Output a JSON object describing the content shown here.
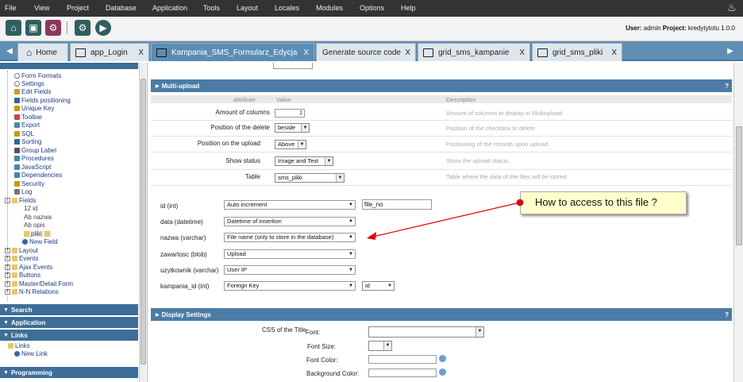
{
  "menu": [
    "File",
    "View",
    "Project",
    "Database",
    "Application",
    "Tools",
    "Layout",
    "Locales",
    "Modules",
    "Options",
    "Help"
  ],
  "icons": {
    "bell": "bell-icon",
    "home": "home-icon",
    "save": "save-icon",
    "gear": "gear-icon",
    "gears": "gears-icon",
    "run": "run-icon"
  },
  "userinfo": {
    "user_label": "User:",
    "user": "admin",
    "project_label": "Project:",
    "project": "kredytytotu",
    "version": "1.0.0"
  },
  "tabs": [
    {
      "label": "Home",
      "close": ""
    },
    {
      "label": "app_Login",
      "close": "X"
    },
    {
      "label": "Kampania_SMS_Formularz_Edycja",
      "close": "X"
    },
    {
      "label": "Generate source code",
      "close": "X"
    },
    {
      "label": "grid_sms_kampanie",
      "close": "X"
    },
    {
      "label": "grid_sms_pliki",
      "close": "X"
    }
  ],
  "tree": {
    "items": [
      "Form Formats",
      "Settings",
      "Edit Fields",
      "Fields positioning",
      "Unique Key",
      "Toolbar",
      "Export",
      "SQL",
      "Sorting",
      "Group Label",
      "Procedures",
      "JavaScript",
      "Dependencies",
      "Security",
      "Log",
      "Fields",
      "12 id",
      "Ab nazwa",
      "Ab opis",
      "pliki",
      "New Field",
      "Layout",
      "Events",
      "Ajax Events",
      "Buttons",
      "Master/Detail Form",
      "N-N Relations"
    ]
  },
  "sections": {
    "search": "Search",
    "application": "Application",
    "links": "Links",
    "programming": "Programming"
  },
  "links_items": [
    "Links",
    "New Link"
  ],
  "multiupload": {
    "title": "Multi-upload",
    "help": "?",
    "head": {
      "attribute": "Attribute",
      "value": "Value",
      "description": "Description"
    },
    "rows": [
      {
        "label": "Amount of columns",
        "value": "1",
        "desc": "Amount of columns to display in Multiupload"
      },
      {
        "label": "Position of the delete",
        "value": "beside",
        "desc": "Position of the checkbox to delete"
      },
      {
        "label": "Position on the upload",
        "value": "Above",
        "desc": "Positioning of the records upon upload"
      },
      {
        "label": "Show status",
        "value": "Image and Text",
        "desc": "Show the upload status."
      },
      {
        "label": "Table",
        "value": "sms_pliki",
        "desc": "Table where the data of the files will be stored"
      }
    ],
    "fields": [
      {
        "label": "id (int)",
        "value": "Auto increment",
        "extra": "file_no"
      },
      {
        "label": "data (datetime)",
        "value": "Datetime of insertion",
        "extra": ""
      },
      {
        "label": "nazwa (varchar)",
        "value": "File name (only to store in the database)",
        "extra": ""
      },
      {
        "label": "zawartosc (blob)",
        "value": "Upload",
        "extra": ""
      },
      {
        "label": "uzytkownik (varchar)",
        "value": "User IP",
        "extra": ""
      },
      {
        "label": "kampania_id (int)",
        "value": "Foreign Key",
        "extra": "id"
      }
    ]
  },
  "tooltip": "How to access to this file ?",
  "display": {
    "title": "Display Settings",
    "help": "?",
    "css_title": "CSS of the Title",
    "font": "Font:",
    "font_size": "Font Size:",
    "font_color": "Font Color:",
    "bg_color": "Background Color:"
  },
  "colors": {
    "menubar": "#333333",
    "tabbar": "#5f8fb5",
    "panel": "#4a7ca6",
    "arrow": "#e00000"
  }
}
